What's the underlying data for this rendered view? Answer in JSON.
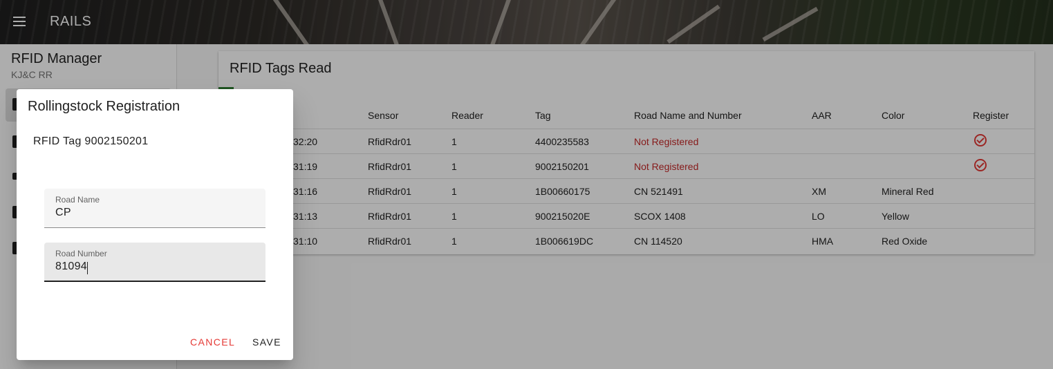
{
  "appbar": {
    "title": "RAILS",
    "menu_icon": "menu-icon"
  },
  "sidenav": {
    "title": "RFID Manager",
    "subtitle": "KJ&C RR"
  },
  "card": {
    "title": "RFID Tags Read",
    "columns": [
      "Sensor",
      "Reader",
      "Tag",
      "Road Name and Number",
      "AAR",
      "Color",
      "Register"
    ],
    "rows": [
      {
        "time": "32:20",
        "sensor": "RfidRdr01",
        "reader": "1",
        "tag": "4400235583",
        "road": "Not Registered",
        "aar": "",
        "color": "",
        "registered": false
      },
      {
        "time": "31:19",
        "sensor": "RfidRdr01",
        "reader": "1",
        "tag": "9002150201",
        "road": "Not Registered",
        "aar": "",
        "color": "",
        "registered": false
      },
      {
        "time": "31:16",
        "sensor": "RfidRdr01",
        "reader": "1",
        "tag": "1B00660175",
        "road": "CN 521491",
        "aar": "XM",
        "color": "Mineral Red",
        "registered": true
      },
      {
        "time": "31:13",
        "sensor": "RfidRdr01",
        "reader": "1",
        "tag": "900215020E",
        "road": "SCOX 1408",
        "aar": "LO",
        "color": "Yellow",
        "registered": true
      },
      {
        "time": "31:10",
        "sensor": "RfidRdr01",
        "reader": "1",
        "tag": "1B006619DC",
        "road": "CN 114520",
        "aar": "HMA",
        "color": "Red Oxide",
        "registered": true
      }
    ],
    "not_registered_color": "#c62828"
  },
  "dialog": {
    "title": "Rollingstock Registration",
    "tag_text": "RFID Tag 9002150201",
    "road_name": {
      "label": "Road Name",
      "value": "CP"
    },
    "road_number": {
      "label": "Road Number",
      "value": "81094"
    },
    "cancel_label": "CANCEL",
    "save_label": "SAVE",
    "accent_color": "#e53935"
  }
}
